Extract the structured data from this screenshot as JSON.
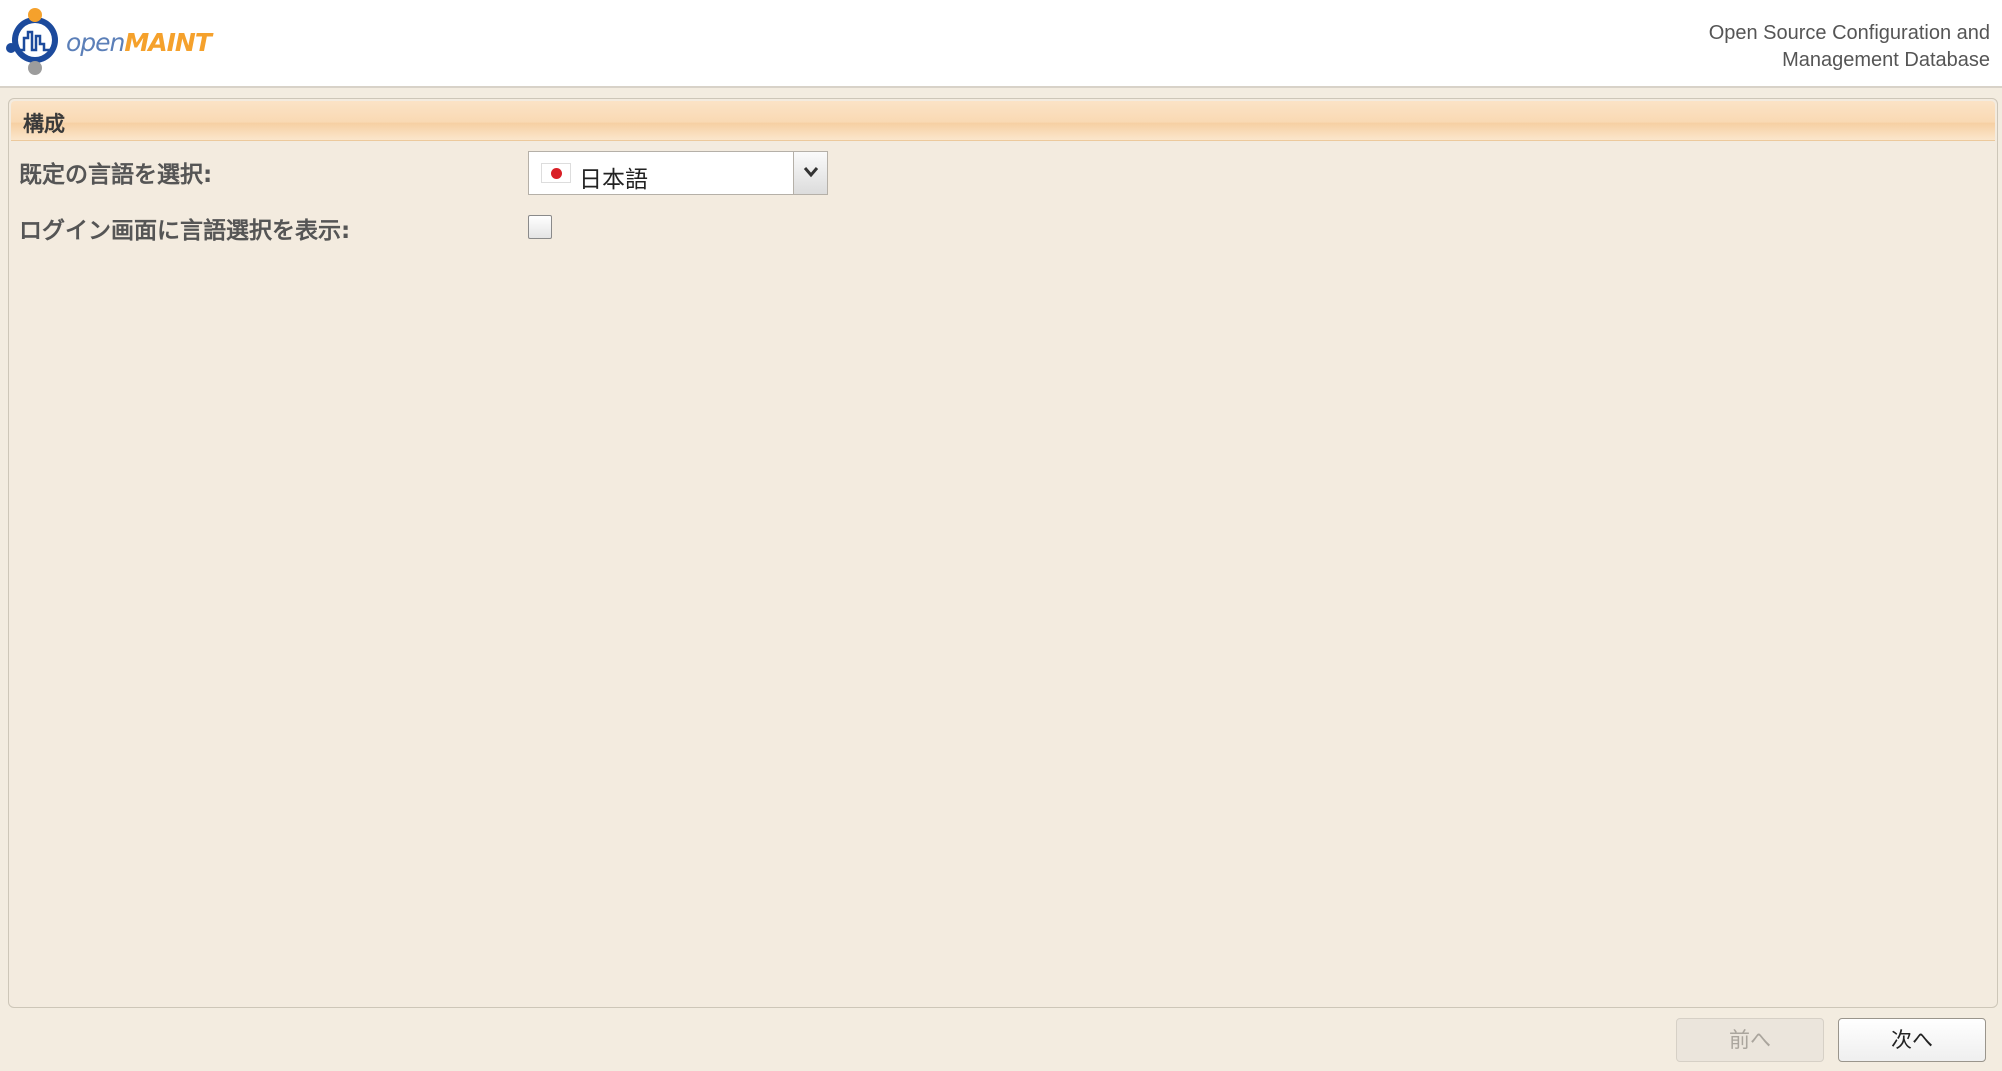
{
  "header": {
    "logo": {
      "part1": "open",
      "part2": "MAINT"
    },
    "tagline_line1": "Open Source Configuration and",
    "tagline_line2": "Management Database"
  },
  "panel": {
    "title": "構成",
    "default_language_label": "既定の言語を選択:",
    "default_language_value": "日本語",
    "default_language_flag": "japan-flag-icon",
    "show_language_label": "ログイン画面に言語選択を表示:",
    "show_language_checked": false
  },
  "footer": {
    "prev_label": "前へ",
    "next_label": "次へ"
  },
  "colors": {
    "background": "#f3ece0",
    "title_bar": "#f9d9b3",
    "logo_blue": "#1c4a9c",
    "logo_orange": "#f5a12c",
    "flag_red": "#d91f26"
  }
}
